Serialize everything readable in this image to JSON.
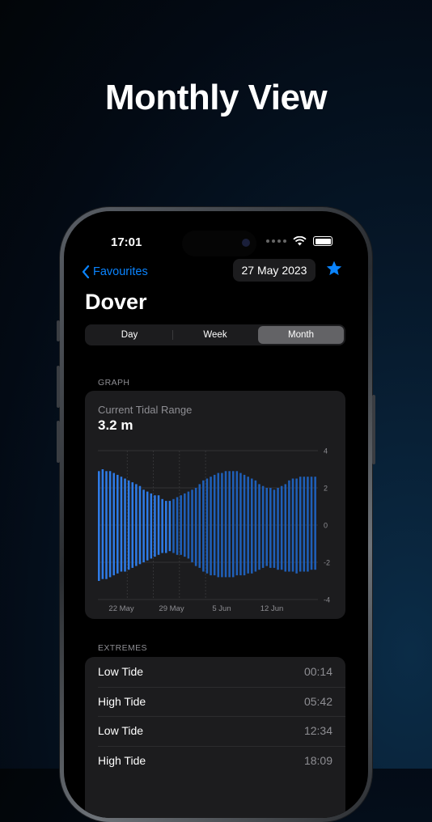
{
  "headline": "Monthly View",
  "status": {
    "time": "17:01"
  },
  "nav": {
    "back_label": "Favourites",
    "date": "27 May 2023"
  },
  "location": {
    "name": "Dover"
  },
  "segments": [
    {
      "label": "Day",
      "active": false
    },
    {
      "label": "Week",
      "active": false
    },
    {
      "label": "Month",
      "active": true
    }
  ],
  "graph": {
    "section_label": "GRAPH",
    "title": "Current Tidal Range",
    "value": "3.2 m"
  },
  "extremes": {
    "section_label": "EXTREMES",
    "rows": [
      {
        "type": "Low Tide",
        "time": "00:14"
      },
      {
        "type": "High Tide",
        "time": "05:42"
      },
      {
        "type": "Low Tide",
        "time": "12:34"
      },
      {
        "type": "High Tide",
        "time": "18:09"
      }
    ]
  },
  "colors": {
    "accent": "#0a84ff",
    "bar_past": "#2e7be6",
    "bar_future": "#1f5fb8"
  },
  "chart_data": {
    "type": "bar",
    "x_tick_labels": [
      "22 May",
      "29 May",
      "5 Jun",
      "12 Jun"
    ],
    "y_ticks": [
      4,
      2,
      0,
      -2,
      -4
    ],
    "ylim": [
      -4,
      4
    ],
    "series": [
      {
        "high": [
          2.9,
          3.0,
          2.9,
          2.9,
          2.8,
          2.7,
          2.6,
          2.5,
          2.4,
          2.3,
          2.2,
          2.1,
          1.9,
          1.8,
          1.7,
          1.6,
          1.6,
          1.4,
          1.3,
          1.3,
          1.4,
          1.5,
          1.6,
          1.7,
          1.8,
          1.9,
          2.0,
          2.2,
          2.4,
          2.5,
          2.6,
          2.7,
          2.8,
          2.8,
          2.9,
          2.9,
          2.9,
          2.9,
          2.8,
          2.7,
          2.6,
          2.5,
          2.4,
          2.2,
          2.1,
          2.0,
          2.0,
          1.9,
          2.0,
          2.1,
          2.2,
          2.4,
          2.5,
          2.5,
          2.6,
          2.6,
          2.6,
          2.6,
          2.6
        ],
        "low": [
          -3.0,
          -2.9,
          -2.9,
          -2.8,
          -2.7,
          -2.6,
          -2.5,
          -2.5,
          -2.4,
          -2.3,
          -2.2,
          -2.1,
          -2.0,
          -1.9,
          -1.8,
          -1.7,
          -1.6,
          -1.5,
          -1.5,
          -1.4,
          -1.5,
          -1.6,
          -1.6,
          -1.7,
          -1.8,
          -2.0,
          -2.2,
          -2.3,
          -2.5,
          -2.6,
          -2.7,
          -2.7,
          -2.8,
          -2.8,
          -2.8,
          -2.8,
          -2.8,
          -2.7,
          -2.7,
          -2.7,
          -2.6,
          -2.6,
          -2.5,
          -2.4,
          -2.3,
          -2.2,
          -2.3,
          -2.3,
          -2.4,
          -2.4,
          -2.5,
          -2.5,
          -2.5,
          -2.6,
          -2.5,
          -2.5,
          -2.5,
          -2.4,
          -2.4
        ]
      }
    ],
    "current_index": 20
  }
}
